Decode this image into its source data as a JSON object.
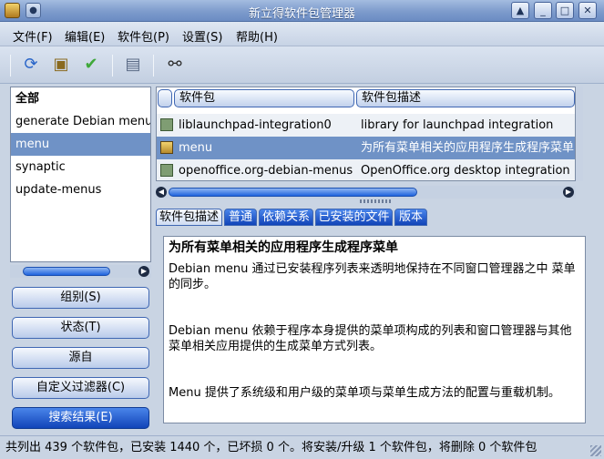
{
  "window": {
    "title": "新立得软件包管理器",
    "buttons": [
      "▲",
      "_",
      "□",
      "✕"
    ]
  },
  "menubar": {
    "items": [
      "文件(F)",
      "编辑(E)",
      "软件包(P)",
      "设置(S)",
      "帮助(H)"
    ]
  },
  "toolbar": {
    "items": [
      "refresh-icon",
      "mark-upgrades-icon",
      "apply-check-icon",
      "properties-icon",
      "search-binoculars-icon"
    ]
  },
  "filters": {
    "items": [
      "全部",
      "generate Debian menu",
      "menu",
      "synaptic",
      "update-menus"
    ],
    "selected": "menu",
    "buttons": [
      "组别(S)",
      "状态(T)",
      "源自",
      "自定义过滤器(C)",
      "搜索结果(E)"
    ],
    "active_button": "搜索结果(E)"
  },
  "packages": {
    "columns": [
      "软件包",
      "软件包描述"
    ],
    "rows": [
      {
        "name": "liblaunchpad-integration0",
        "desc": "library for launchpad integration"
      },
      {
        "name": "menu",
        "desc": "为所有菜单相关的应用程序生成程序菜单"
      },
      {
        "name": "openoffice.org-debian-menus",
        "desc": "OpenOffice.org desktop integration"
      }
    ]
  },
  "tabs": [
    "软件包描述",
    "普通",
    "依赖关系",
    "已安装的文件",
    "版本"
  ],
  "details": {
    "title": "为所有菜单相关的应用程序生成程序菜单",
    "paragraphs": [
      "Debian menu 通过已安装程序列表来透明地保持在不同窗口管理器之中 菜单的同步。",
      "Debian menu 依赖于程序本身提供的菜单项构成的列表和窗口管理器与其他菜单相关应用提供的生成菜单方式列表。",
      "Menu 提供了系统级和用户级的菜单项与菜单生成方法的配置与重载机制。"
    ]
  },
  "status": {
    "text": "共列出 439 个软件包，已安装 1440 个，已坏损 0 个。将安装/升级 1 个软件包，将删除 0 个软件包"
  }
}
